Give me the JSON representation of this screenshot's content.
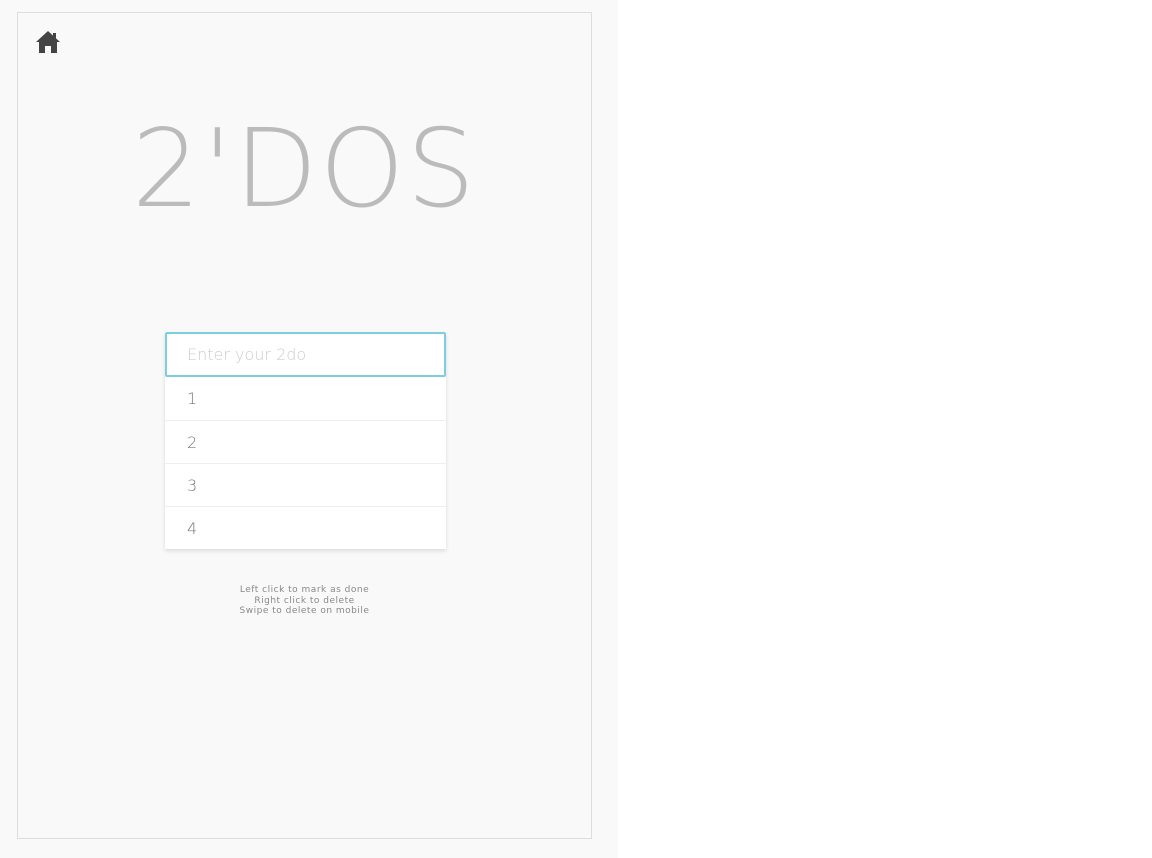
{
  "nav": {
    "home_icon": "home-icon",
    "icon_color": "#444444"
  },
  "header": {
    "title": "2'DOS"
  },
  "todo_input": {
    "placeholder": "Enter your 2do",
    "value": ""
  },
  "todos": [
    {
      "label": "1"
    },
    {
      "label": "2"
    },
    {
      "label": "3"
    },
    {
      "label": "4"
    }
  ],
  "help": {
    "line1": "Left click to mark as done",
    "line2": "Right click to delete",
    "line3": "Swipe to delete on mobile"
  },
  "colors": {
    "accent_border": "#7dcfe0",
    "title": "#bbbbbb",
    "panel_bg": "#f9f9f9"
  }
}
